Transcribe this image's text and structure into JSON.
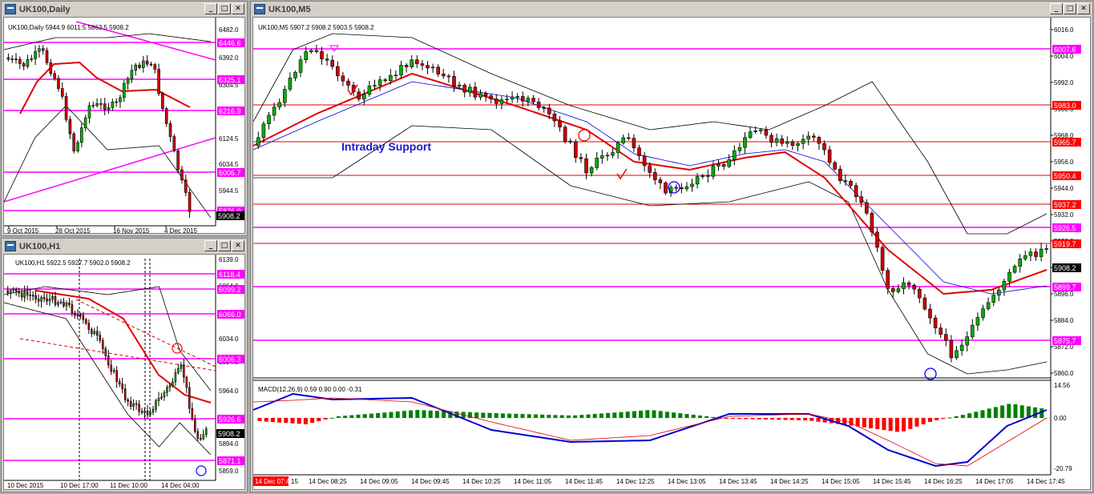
{
  "windows": {
    "daily": {
      "title": "UK100,Daily",
      "info": "UK100,Daily 5944.9 6011.5 5863.5 5908.2",
      "price_labels": [
        "6482.0",
        "6392.0",
        "6304.5",
        "6214.5",
        "6124.5",
        "6034.5",
        "5944.5",
        "5854.5"
      ],
      "level_tags": [
        "6446.6",
        "6325.1",
        "6216.9",
        "6006.7",
        "5876.0"
      ],
      "current_price": "5908.2",
      "time_labels": [
        "9 Oct 2015",
        "28 Oct 2015",
        "16 Nov 2015",
        "4 Dec 2015"
      ]
    },
    "h1": {
      "title": "UK100,H1",
      "info": "UK100,H1 5922.5 5927.7 5902.0 5908.2",
      "price_labels": [
        "6139.0",
        "6064.0",
        "6034.0",
        "5994.0",
        "5964.0",
        "5894.0",
        "5859.0"
      ],
      "level_tags": [
        "6118.4",
        "6099.2",
        "6066.0",
        "6006.3",
        "5926.6",
        "5871.1"
      ],
      "current_price": "5908.2",
      "time_labels": [
        "10 Dec 2015",
        "10 Dec 17:00",
        "11 Dec 10:00",
        "14 Dec 04:00"
      ]
    },
    "m5": {
      "title": "UK100,M5",
      "info": "UK100,M5 5907.2 5908.2 5903.5 5908.2",
      "price_labels": [
        "6016.0",
        "6004.0",
        "5992.0",
        "5980.0",
        "5968.0",
        "5956.0",
        "5944.0",
        "5932.0",
        "5920.0",
        "5908.0",
        "5896.0",
        "5884.0",
        "5872.0",
        "5860.0"
      ],
      "level_tags": [
        "6007.6",
        "5983.0",
        "5965.7",
        "5950.4",
        "5937.2",
        "5926.5",
        "5919.7",
        "5899.7",
        "5875.7"
      ],
      "current_price": "5908.2",
      "annotation": "Intraday Support",
      "macd_info": "MACD(12,26,9) 0.59 0.90 0.00 -0.31",
      "macd_scale": [
        "14.56",
        "0.00",
        "-20.79"
      ],
      "time_cursor": "14 Dec 07:45",
      "time_labels": [
        "15",
        "14 Dec 08:25",
        "14 Dec 09:05",
        "14 Dec 09:45",
        "14 Dec 10:25",
        "14 Dec 11:05",
        "14 Dec 11:45",
        "14 Dec 12:25",
        "14 Dec 13:05",
        "14 Dec 13:45",
        "14 Dec 14:25",
        "14 Dec 15:05",
        "14 Dec 15:45",
        "14 Dec 16:25",
        "14 Dec 17:05",
        "14 Dec 17:45"
      ]
    }
  },
  "colors": {
    "bull": "#00b000",
    "bear": "#d00000",
    "level": "#ff00ff",
    "red_level": "#e00000",
    "ma": "#e00000",
    "signal": "#0000d0",
    "hist_pos": "#008000",
    "hist_neg": "#ff0000",
    "tag_pink": "#ff00ff",
    "tag_red": "#ff0000"
  }
}
